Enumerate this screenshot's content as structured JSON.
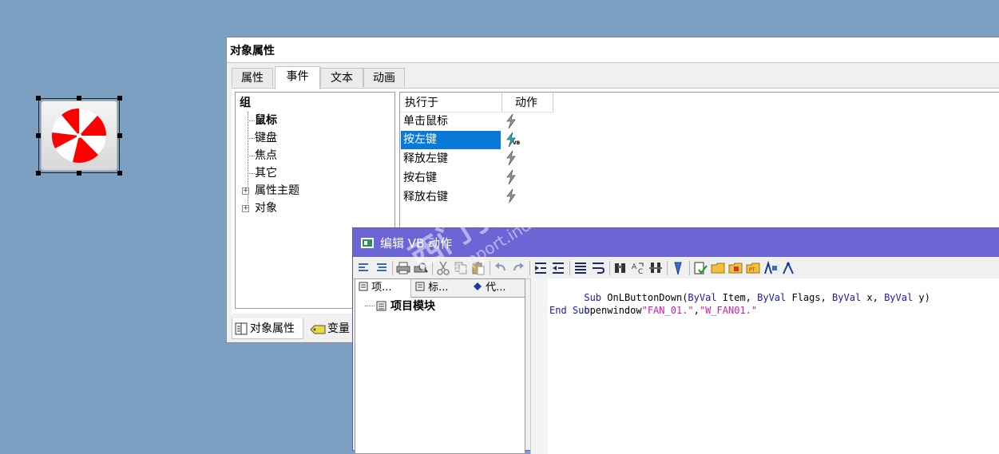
{
  "properties_window": {
    "title": "对象属性",
    "tabs": [
      "属性",
      "事件",
      "文本",
      "动画"
    ],
    "tree": {
      "root": "组",
      "items": [
        "鼠标",
        "键盘",
        "焦点",
        "其它"
      ],
      "expandable": [
        "属性主题",
        "对象"
      ]
    },
    "grid": {
      "columns": [
        "执行于",
        "动作"
      ],
      "events": [
        "单击鼠标",
        "按左键",
        "释放左键",
        "按右键",
        "释放右键"
      ],
      "selected_event": "按左键",
      "action_badge": "VB"
    },
    "bottom_tabs": [
      "对象属性",
      "变量"
    ]
  },
  "vb_editor": {
    "title": "编辑 VB 动作",
    "left_tabs": [
      "项...",
      "标...",
      "代..."
    ],
    "tree_item": "项目模块",
    "code": {
      "line1_kw_sub": "Sub",
      "line1_name": " OnLButtonDown(",
      "line1_kw_byval1": "ByVal",
      "line1_item": " Item, ",
      "line1_kw_byval2": "ByVal",
      "line1_flags": " Flags, ",
      "line1_kw_byval3": "ByVal",
      "line1_x": " x, ",
      "line1_kw_byval4": "ByVal",
      "line1_y": " y)",
      "line2_call": "openwindow",
      "line2_arg1": "\"FAN_01.\"",
      "line2_comma": ",",
      "line2_arg2": "\"W_FAN01.\"",
      "line3_end": "End Sub"
    }
  },
  "watermark": {
    "brand": "西门子工业",
    "tagline": "找答案",
    "url": "support.industry.siemens.com/cs"
  },
  "colors": {
    "desktop": "#7ba0c1",
    "selection": "#0a78d7",
    "vb_titlebar": "#6c65d6",
    "fan_red": "#ff0000",
    "code_keyword": "#1a1aa6",
    "code_string": "#d020a8"
  }
}
